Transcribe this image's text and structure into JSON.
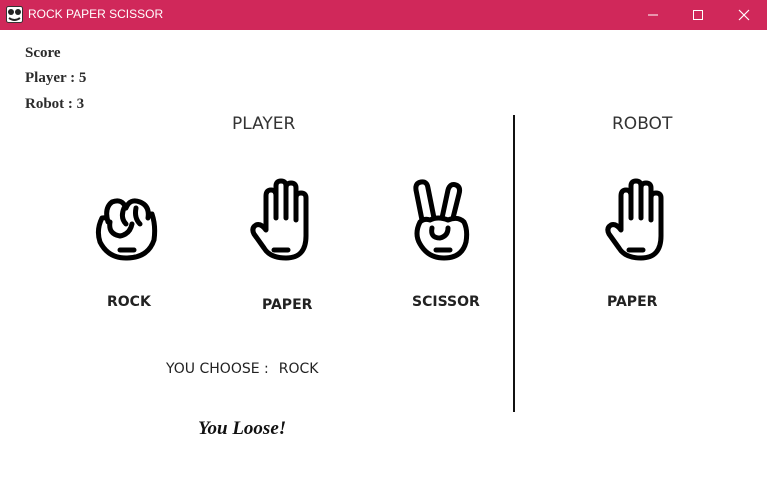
{
  "window": {
    "title": "ROCK PAPER SCISSOR",
    "icon": "app-icon",
    "controls": [
      "minimize-icon",
      "maximize-icon",
      "close-icon"
    ]
  },
  "score": {
    "title": "Score",
    "player": "Player : 5",
    "robot": "Robot : 3"
  },
  "player": {
    "heading": "PLAYER",
    "choices": [
      {
        "label": "ROCK",
        "icon": "fist-icon"
      },
      {
        "label": "PAPER",
        "icon": "open-hand-icon"
      },
      {
        "label": "SCISSOR",
        "icon": "peace-hand-icon"
      }
    ],
    "you_choose_label": "YOU CHOOSE :",
    "you_choose_value": "ROCK"
  },
  "robot": {
    "heading": "ROBOT",
    "choice_label": "PAPER",
    "choice_icon": "open-hand-icon"
  },
  "result": "You Loose!",
  "colors": {
    "titlebar": "#d0285a",
    "text": "#222222"
  }
}
